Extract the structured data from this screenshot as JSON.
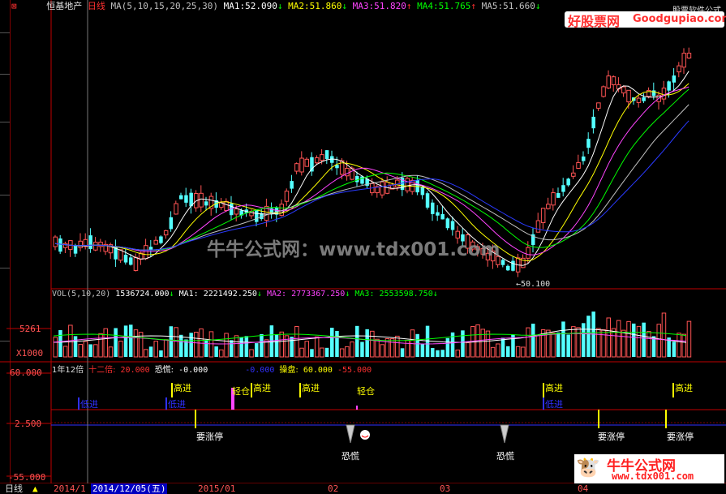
{
  "header": {
    "stock_name": "恒基地产",
    "period": "日线",
    "ma_params": "MA(5,10,15,20,25,30)",
    "ma": [
      {
        "label": "MA1:",
        "value": "52.090",
        "arrow": "↓",
        "color": "#ffffff"
      },
      {
        "label": "MA2:",
        "value": "51.860",
        "arrow": "↓",
        "color": "#ffff00"
      },
      {
        "label": "MA3:",
        "value": "51.820",
        "arrow": "↑",
        "color": "#ff44ff"
      },
      {
        "label": "MA4:",
        "value": "51.765",
        "arrow": "↑",
        "color": "#00ff00"
      },
      {
        "label": "MA5:",
        "value": "51.660",
        "arrow": "↓",
        "color": "#c0c0c0"
      }
    ],
    "arrow_down_color": "#00ff00",
    "arrow_up_color": "#ff3030"
  },
  "watermark_top": {
    "brand": "好股票网",
    "url": "Goodgupiao.com",
    "caption": "股票软件公式"
  },
  "watermark_center": "牛牛公式网：www.tdx001.com",
  "watermark_bottom": {
    "brand": "牛牛公式网",
    "url": "www.tdx001.com"
  },
  "price_panel": {
    "low_label": "←50.100"
  },
  "vol_panel": {
    "params": "VOL(5,10,20)",
    "vol_value": "1536724.000",
    "ma1": "2221492.250",
    "ma2": "2773367.250",
    "ma3": "2553598.750",
    "axis_tick": "5261",
    "axis_unit": "X1000"
  },
  "indicator_panel": {
    "title": "1年12倍",
    "item1_label": "十二倍:",
    "item1_value": "20.000",
    "item2_label": "恐慌:",
    "item2_value": "-0.000",
    "item3_value": "-0.000",
    "item4_label": "操盘:",
    "item4_value": "60.000",
    "item5_value": "-55.000",
    "axis": [
      "60.000",
      "2.500",
      "-55.000"
    ],
    "signals": {
      "buy": "低进",
      "high": "高进",
      "light": "轻仓",
      "limit": "要涨停",
      "panic": "恐慌"
    }
  },
  "bottom_bar": {
    "period_tab": "日线",
    "dates": [
      "2014/1",
      "2014/12/05(五)",
      "2015/01",
      "02",
      "03",
      "04"
    ]
  },
  "colors": {
    "up": "#ff5454",
    "down": "#54ffff",
    "border": "#c00000",
    "ma_blue": "#2a3aff"
  }
}
